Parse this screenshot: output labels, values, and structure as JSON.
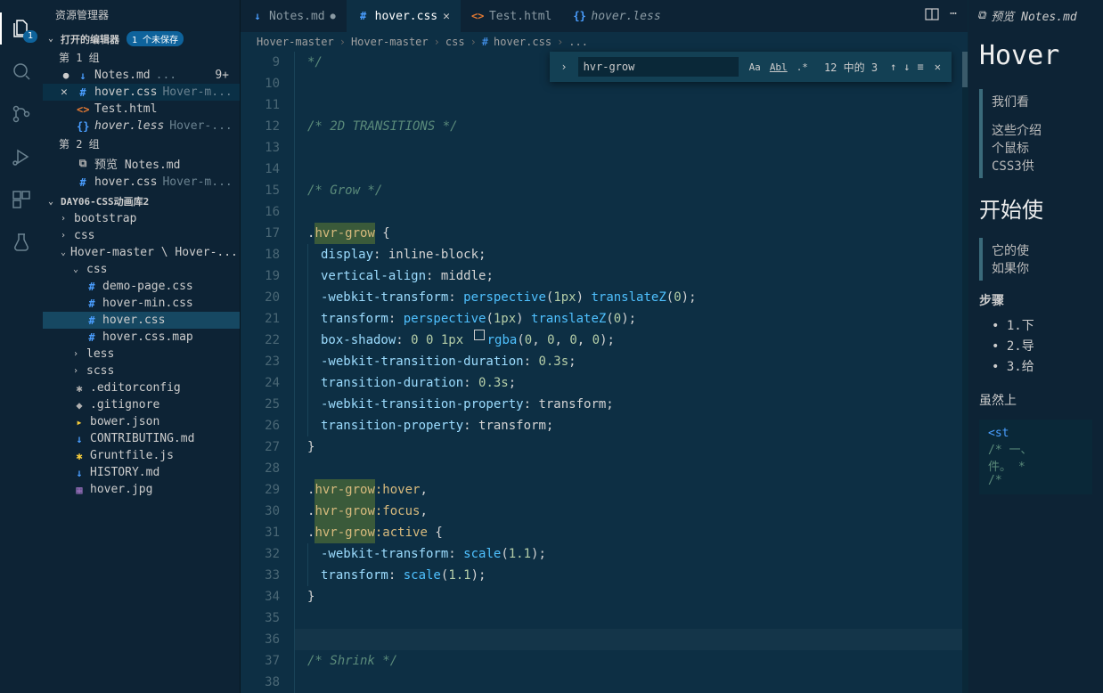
{
  "activityBar": {
    "badge": "1"
  },
  "sidebar": {
    "title": "资源管理器",
    "openEditors": {
      "label": "打开的编辑器",
      "unsavedBadge": "1 个未保存",
      "group1": "第 1 组",
      "group2": "第 2 组",
      "files": [
        {
          "name": "Notes.md",
          "path": "...",
          "count": "9+",
          "modified": true,
          "icon": "↓",
          "iconClass": "ic-md"
        },
        {
          "name": "hover.css",
          "path": "Hover-m...",
          "active": true,
          "closeBtn": true,
          "icon": "#",
          "iconClass": "ic-css"
        },
        {
          "name": "Test.html",
          "path": "",
          "icon": "<>",
          "iconClass": "ic-html"
        },
        {
          "name": "hover.less",
          "path": "Hover-...",
          "italic": true,
          "icon": "{}",
          "iconClass": "ic-less"
        }
      ],
      "group2Files": [
        {
          "name": "预览 Notes.md",
          "icon": "⧉",
          "iconClass": "ic-file"
        },
        {
          "name": "hover.css",
          "path": "Hover-m...",
          "icon": "#",
          "iconClass": "ic-css"
        }
      ]
    },
    "folderName": "DAY06-CSS动画库2",
    "tree": [
      {
        "name": "bootstrap",
        "type": "folder",
        "indent": 1,
        "chev": "›"
      },
      {
        "name": "css",
        "type": "folder",
        "indent": 1,
        "chev": "›"
      },
      {
        "name": "Hover-master \\ Hover-...",
        "type": "folder",
        "indent": 1,
        "chev": "⌄"
      },
      {
        "name": "css",
        "type": "folder",
        "indent": 2,
        "chev": "⌄"
      },
      {
        "name": "demo-page.css",
        "type": "file",
        "indent": 3,
        "icon": "#",
        "iconClass": "ic-css"
      },
      {
        "name": "hover-min.css",
        "type": "file",
        "indent": 3,
        "icon": "#",
        "iconClass": "ic-css"
      },
      {
        "name": "hover.css",
        "type": "file",
        "indent": 3,
        "icon": "#",
        "iconClass": "ic-css",
        "selected": true
      },
      {
        "name": "hover.css.map",
        "type": "file",
        "indent": 3,
        "icon": "#",
        "iconClass": "ic-css"
      },
      {
        "name": "less",
        "type": "folder",
        "indent": 2,
        "chev": "›"
      },
      {
        "name": "scss",
        "type": "folder",
        "indent": 2,
        "chev": "›"
      },
      {
        "name": ".editorconfig",
        "type": "file",
        "indent": 2,
        "icon": "✱",
        "iconClass": "ic-file"
      },
      {
        "name": ".gitignore",
        "type": "file",
        "indent": 2,
        "icon": "◆",
        "iconClass": "ic-file"
      },
      {
        "name": "bower.json",
        "type": "file",
        "indent": 2,
        "icon": "▸",
        "iconClass": "ic-json"
      },
      {
        "name": "CONTRIBUTING.md",
        "type": "file",
        "indent": 2,
        "icon": "↓",
        "iconClass": "ic-md"
      },
      {
        "name": "Gruntfile.js",
        "type": "file",
        "indent": 2,
        "icon": "✱",
        "iconClass": "ic-js"
      },
      {
        "name": "HISTORY.md",
        "type": "file",
        "indent": 2,
        "icon": "↓",
        "iconClass": "ic-md"
      },
      {
        "name": "hover.jpg",
        "type": "file",
        "indent": 2,
        "icon": "▦",
        "iconClass": "ic-img"
      }
    ]
  },
  "tabs": [
    {
      "name": "Notes.md",
      "icon": "↓",
      "iconClass": "ic-md",
      "modified": true
    },
    {
      "name": "hover.css",
      "icon": "#",
      "iconClass": "ic-css",
      "active": true,
      "close": true
    },
    {
      "name": "Test.html",
      "icon": "<>",
      "iconClass": "ic-html"
    },
    {
      "name": "hover.less",
      "icon": "{}",
      "iconClass": "ic-less",
      "italic": true
    }
  ],
  "breadcrumbs": [
    "Hover-master",
    "Hover-master",
    "css",
    "hover.css",
    "..."
  ],
  "findWidget": {
    "value": "hvr-grow",
    "result": "12 中的 3"
  },
  "code": {
    "startLine": 9,
    "lines": [
      {
        "n": 9,
        "t": [
          {
            "c": "tok-comment",
            "v": "*/"
          }
        ]
      },
      {
        "n": 10,
        "t": []
      },
      {
        "n": 11,
        "t": []
      },
      {
        "n": 12,
        "t": [
          {
            "c": "tok-comment",
            "v": "/* 2D TRANSITIONS */"
          }
        ]
      },
      {
        "n": 13,
        "t": []
      },
      {
        "n": 14,
        "t": []
      },
      {
        "n": 15,
        "t": [
          {
            "c": "tok-comment",
            "v": "/* Grow */"
          }
        ]
      },
      {
        "n": 16,
        "t": []
      },
      {
        "n": 17,
        "t": [
          {
            "c": "tok-punc",
            "v": "."
          },
          {
            "c": "tok-sel tok-sel-hl",
            "v": "hvr-grow"
          },
          {
            "c": "tok-punc",
            "v": " {"
          }
        ]
      },
      {
        "n": 18,
        "indent": true,
        "t": [
          {
            "c": "tok-prop",
            "v": "display"
          },
          {
            "c": "tok-punc",
            "v": ": "
          },
          {
            "c": "tok-val",
            "v": "inline-block"
          },
          {
            "c": "tok-punc",
            "v": ";"
          }
        ]
      },
      {
        "n": 19,
        "indent": true,
        "t": [
          {
            "c": "tok-prop",
            "v": "vertical-align"
          },
          {
            "c": "tok-punc",
            "v": ": "
          },
          {
            "c": "tok-val",
            "v": "middle"
          },
          {
            "c": "tok-punc",
            "v": ";"
          }
        ]
      },
      {
        "n": 20,
        "indent": true,
        "t": [
          {
            "c": "tok-prop",
            "v": "-webkit-transform"
          },
          {
            "c": "tok-punc",
            "v": ": "
          },
          {
            "c": "tok-func",
            "v": "perspective"
          },
          {
            "c": "tok-punc",
            "v": "("
          },
          {
            "c": "tok-num",
            "v": "1px"
          },
          {
            "c": "tok-punc",
            "v": ") "
          },
          {
            "c": "tok-func",
            "v": "translateZ"
          },
          {
            "c": "tok-punc",
            "v": "("
          },
          {
            "c": "tok-num",
            "v": "0"
          },
          {
            "c": "tok-punc",
            "v": ");"
          }
        ]
      },
      {
        "n": 21,
        "indent": true,
        "t": [
          {
            "c": "tok-prop",
            "v": "transform"
          },
          {
            "c": "tok-punc",
            "v": ": "
          },
          {
            "c": "tok-func",
            "v": "perspective"
          },
          {
            "c": "tok-punc",
            "v": "("
          },
          {
            "c": "tok-num",
            "v": "1px"
          },
          {
            "c": "tok-punc",
            "v": ") "
          },
          {
            "c": "tok-func",
            "v": "translateZ"
          },
          {
            "c": "tok-punc",
            "v": "("
          },
          {
            "c": "tok-num",
            "v": "0"
          },
          {
            "c": "tok-punc",
            "v": ");"
          }
        ]
      },
      {
        "n": 22,
        "indent": true,
        "t": [
          {
            "c": "tok-prop",
            "v": "box-shadow"
          },
          {
            "c": "tok-punc",
            "v": ": "
          },
          {
            "c": "tok-num",
            "v": "0 0 1px"
          },
          {
            "c": "",
            "v": " "
          },
          {
            "c": "colorbox",
            "v": ""
          },
          {
            "c": "tok-func",
            "v": "rgba"
          },
          {
            "c": "tok-punc",
            "v": "("
          },
          {
            "c": "tok-num",
            "v": "0"
          },
          {
            "c": "tok-punc",
            "v": ", "
          },
          {
            "c": "tok-num",
            "v": "0"
          },
          {
            "c": "tok-punc",
            "v": ", "
          },
          {
            "c": "tok-num",
            "v": "0"
          },
          {
            "c": "tok-punc",
            "v": ", "
          },
          {
            "c": "tok-num",
            "v": "0"
          },
          {
            "c": "tok-punc",
            "v": ");"
          }
        ]
      },
      {
        "n": 23,
        "indent": true,
        "t": [
          {
            "c": "tok-prop",
            "v": "-webkit-transition-duration"
          },
          {
            "c": "tok-punc",
            "v": ": "
          },
          {
            "c": "tok-num",
            "v": "0.3s"
          },
          {
            "c": "tok-punc",
            "v": ";"
          }
        ]
      },
      {
        "n": 24,
        "indent": true,
        "t": [
          {
            "c": "tok-prop",
            "v": "transition-duration"
          },
          {
            "c": "tok-punc",
            "v": ": "
          },
          {
            "c": "tok-num",
            "v": "0.3s"
          },
          {
            "c": "tok-punc",
            "v": ";"
          }
        ]
      },
      {
        "n": 25,
        "indent": true,
        "t": [
          {
            "c": "tok-prop",
            "v": "-webkit-transition-property"
          },
          {
            "c": "tok-punc",
            "v": ": "
          },
          {
            "c": "tok-val",
            "v": "transform"
          },
          {
            "c": "tok-punc",
            "v": ";"
          }
        ]
      },
      {
        "n": 26,
        "indent": true,
        "t": [
          {
            "c": "tok-prop",
            "v": "transition-property"
          },
          {
            "c": "tok-punc",
            "v": ": "
          },
          {
            "c": "tok-val",
            "v": "transform"
          },
          {
            "c": "tok-punc",
            "v": ";"
          }
        ]
      },
      {
        "n": 27,
        "t": [
          {
            "c": "tok-punc",
            "v": "}"
          }
        ]
      },
      {
        "n": 28,
        "t": []
      },
      {
        "n": 29,
        "t": [
          {
            "c": "tok-punc",
            "v": "."
          },
          {
            "c": "tok-sel tok-sel-hl",
            "v": "hvr-grow"
          },
          {
            "c": "tok-sel",
            "v": ":hover"
          },
          {
            "c": "tok-punc",
            "v": ","
          }
        ]
      },
      {
        "n": 30,
        "t": [
          {
            "c": "tok-punc",
            "v": "."
          },
          {
            "c": "tok-sel tok-sel-hl",
            "v": "hvr-grow"
          },
          {
            "c": "tok-sel",
            "v": ":focus"
          },
          {
            "c": "tok-punc",
            "v": ","
          }
        ]
      },
      {
        "n": 31,
        "t": [
          {
            "c": "tok-punc",
            "v": "."
          },
          {
            "c": "tok-sel tok-sel-hl",
            "v": "hvr-grow"
          },
          {
            "c": "tok-sel",
            "v": ":active"
          },
          {
            "c": "tok-punc",
            "v": " {"
          }
        ]
      },
      {
        "n": 32,
        "indent": true,
        "t": [
          {
            "c": "tok-prop",
            "v": "-webkit-transform"
          },
          {
            "c": "tok-punc",
            "v": ": "
          },
          {
            "c": "tok-func",
            "v": "scale"
          },
          {
            "c": "tok-punc",
            "v": "("
          },
          {
            "c": "tok-num",
            "v": "1.1"
          },
          {
            "c": "tok-punc",
            "v": ");"
          }
        ]
      },
      {
        "n": 33,
        "indent": true,
        "t": [
          {
            "c": "tok-prop",
            "v": "transform"
          },
          {
            "c": "tok-punc",
            "v": ": "
          },
          {
            "c": "tok-func",
            "v": "scale"
          },
          {
            "c": "tok-punc",
            "v": "("
          },
          {
            "c": "tok-num",
            "v": "1.1"
          },
          {
            "c": "tok-punc",
            "v": ");"
          }
        ]
      },
      {
        "n": 34,
        "t": [
          {
            "c": "tok-punc",
            "v": "}"
          }
        ]
      },
      {
        "n": 35,
        "t": []
      },
      {
        "n": 36,
        "cursor": true,
        "t": []
      },
      {
        "n": 37,
        "t": [
          {
            "c": "tok-comment",
            "v": "/* Shrink */"
          }
        ]
      },
      {
        "n": 38,
        "t": []
      }
    ]
  },
  "preview": {
    "tabLabel": "预览 Notes.md",
    "h1": "Hover",
    "quote1a": "我们看",
    "quote1b": "这些介绍",
    "quote1c": "个鼠标",
    "quote1d": "CSS3供",
    "h2": "开始使",
    "quote2a": "它的使",
    "quote2b": "如果你",
    "stepsTitle": "步骤",
    "steps": [
      "1.下",
      "2.导",
      "3.给"
    ],
    "para": "虽然上",
    "code_st": "<st",
    "code_c1": "/*  一、",
    "code_c2": "件。 *",
    "code_c3": "/*"
  }
}
